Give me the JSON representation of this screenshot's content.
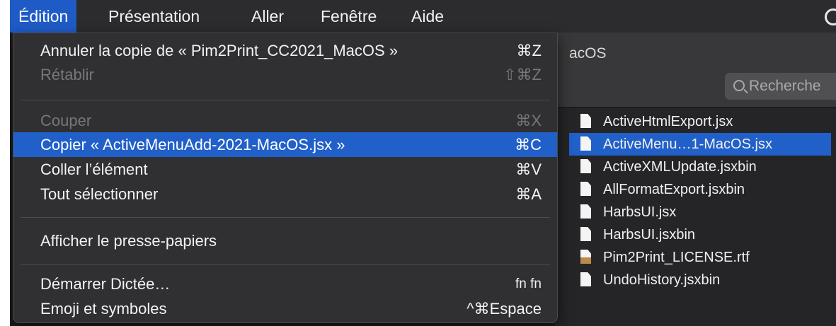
{
  "menubar": {
    "items": [
      "Édition",
      "Présentation",
      "Aller",
      "Fenêtre",
      "Aide"
    ],
    "active_index": 0
  },
  "edit_menu": {
    "undo": {
      "label": "Annuler la copie de « Pim2Print_CC2021_MacOS »",
      "shortcut": "⌘Z",
      "enabled": true
    },
    "redo": {
      "label": "Rétablir",
      "shortcut": "⇧⌘Z",
      "enabled": false
    },
    "cut": {
      "label": "Couper",
      "shortcut": "⌘X",
      "enabled": false
    },
    "copy": {
      "label": "Copier « ActiveMenuAdd-2021-MacOS.jsx »",
      "shortcut": "⌘C",
      "highlighted": true
    },
    "paste": {
      "label": "Coller l’élément",
      "shortcut": "⌘V"
    },
    "select_all": {
      "label": "Tout sélectionner",
      "shortcut": "⌘A"
    },
    "show_clipboard": {
      "label": "Afficher le presse-papiers"
    },
    "dictation": {
      "label": "Démarrer Dictée…",
      "shortcut": "fn fn"
    },
    "emoji": {
      "label": "Emoji et symboles",
      "shortcut": "^⌘Espace"
    }
  },
  "finder": {
    "title_fragment": "acOS",
    "search_placeholder": "Recherche",
    "search_icon": "magnifier-icon",
    "files": [
      {
        "name": "ActiveHtmlExport.jsx",
        "icon": "document-icon",
        "selected": false
      },
      {
        "name": "ActiveMenu…1-MacOS.jsx",
        "icon": "document-icon",
        "selected": true
      },
      {
        "name": "ActiveXMLUpdate.jsxbin",
        "icon": "document-icon",
        "selected": false
      },
      {
        "name": "AllFormatExport.jsxbin",
        "icon": "document-icon",
        "selected": false
      },
      {
        "name": "HarbsUI.jsx",
        "icon": "document-icon",
        "selected": false
      },
      {
        "name": "HarbsUI.jsxbin",
        "icon": "document-icon",
        "selected": false
      },
      {
        "name": "Pim2Print_LICENSE.rtf",
        "icon": "rtf-document-icon",
        "selected": false
      },
      {
        "name": "UndoHistory.jsxbin",
        "icon": "document-icon",
        "selected": false
      }
    ]
  },
  "colors": {
    "highlight": "#2160c9",
    "menu_bg": "#303032",
    "menubar_bg": "#2c2c2e"
  }
}
